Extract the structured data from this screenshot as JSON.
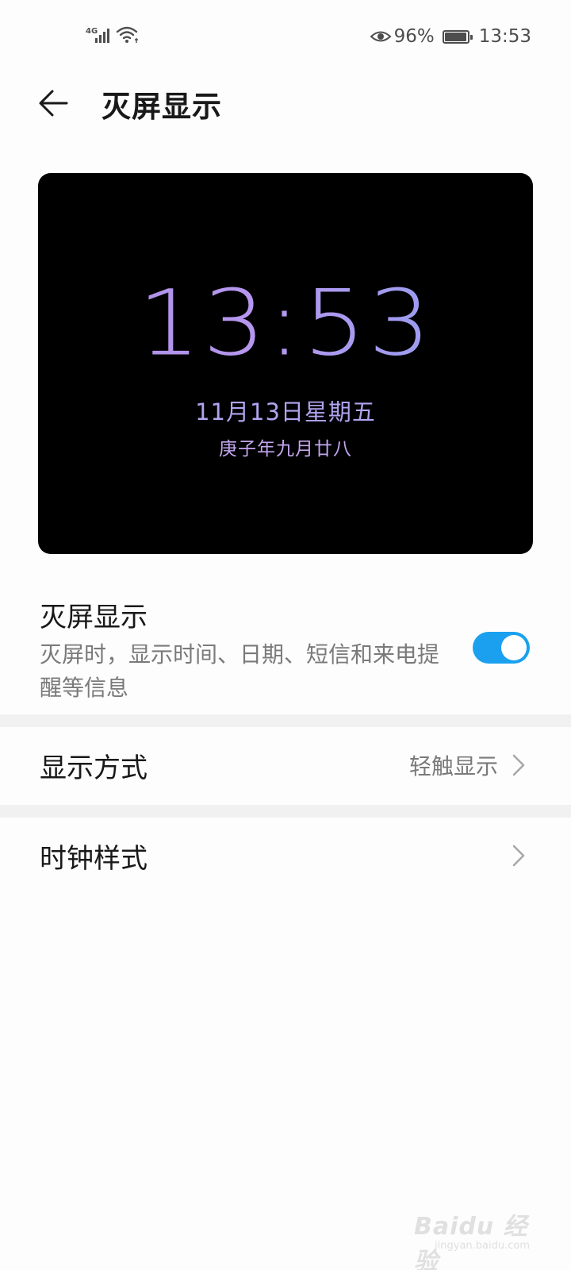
{
  "status_bar": {
    "network_type": "4G",
    "battery_percent": "96%",
    "battery_level": 0.96,
    "time": "13:53"
  },
  "header": {
    "title": "灭屏显示"
  },
  "preview": {
    "time": "13:53",
    "date": "11月13日星期五",
    "lunar_date": "庚子年九月廿八"
  },
  "aod_setting": {
    "title": "灭屏显示",
    "description": "灭屏时，显示时间、日期、短信和来电提醒等信息",
    "enabled": true
  },
  "display_mode": {
    "label": "显示方式",
    "value": "轻触显示"
  },
  "clock_style": {
    "label": "时钟样式"
  },
  "watermark": {
    "main": "Baidu 经验",
    "sub": "jingyan.baidu.com"
  },
  "colors": {
    "toggle_on": "#1aa0ef",
    "preview_bg": "#000000",
    "clock_gradient_start": "#a98ee4",
    "clock_gradient_end": "#8aa0f0"
  }
}
